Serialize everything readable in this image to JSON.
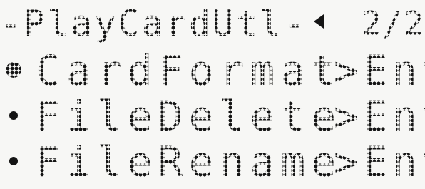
{
  "header": {
    "title": "-PlayCardUtl-",
    "page_indicator": "2/2",
    "page_prev_icon": "triangle-left-icon"
  },
  "menu": {
    "items": [
      {
        "label": "CardFormat",
        "action": ">Ent",
        "selected": true
      },
      {
        "label": "FileDelete",
        "action": ">Ent",
        "selected": false
      },
      {
        "label": "FileRename",
        "action": ">Ent",
        "selected": false
      }
    ]
  },
  "colors": {
    "lcd_background": "#f7f7f5",
    "lcd_pixel": "#141414"
  }
}
